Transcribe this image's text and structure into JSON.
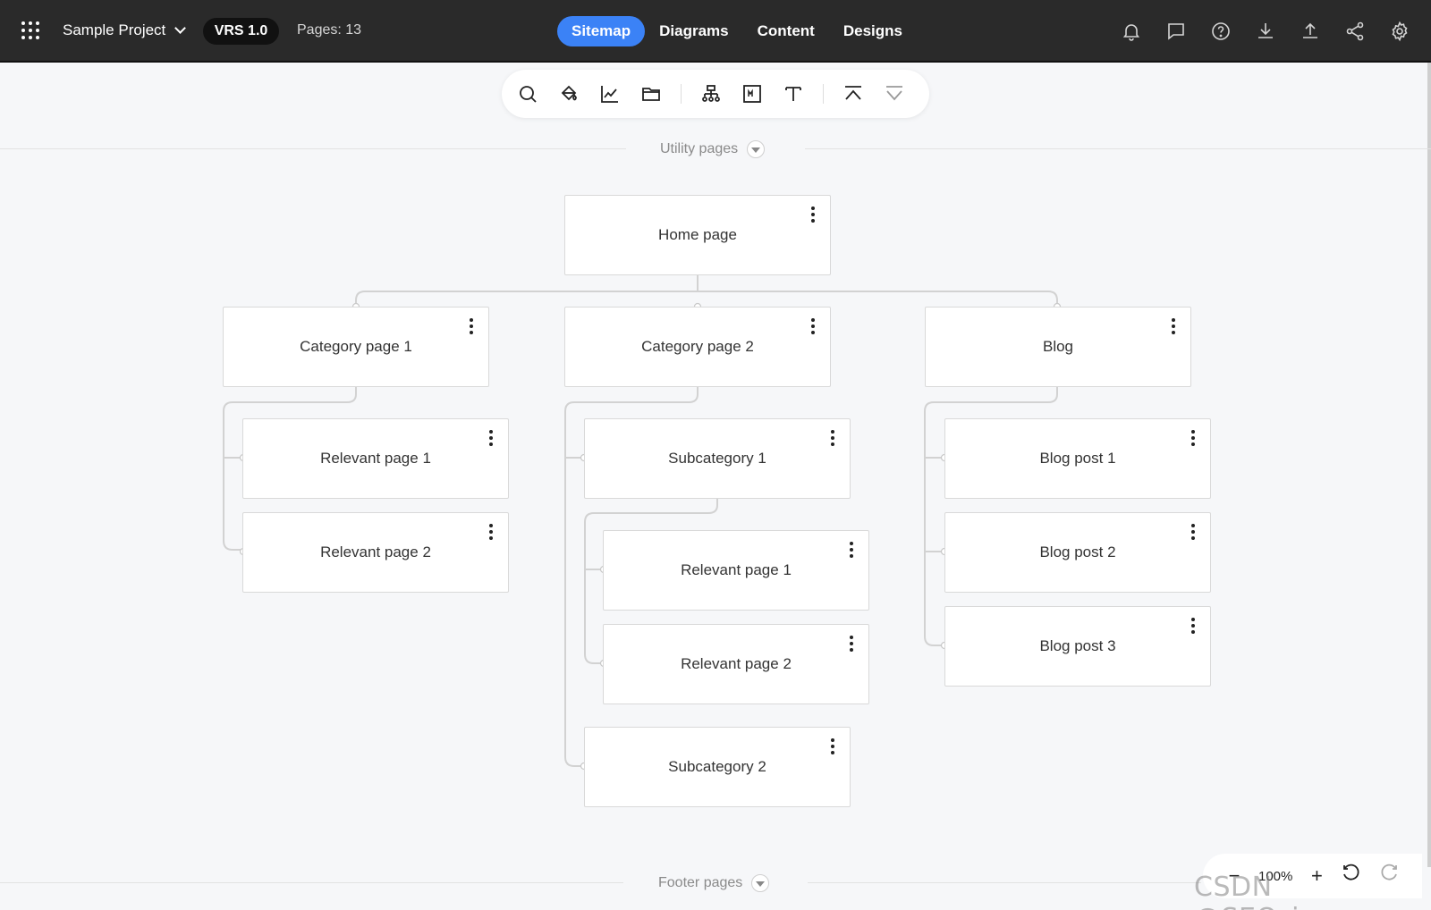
{
  "header": {
    "project_name": "Sample Project",
    "version": "VRS 1.0",
    "pages_count": "Pages: 13",
    "tabs": [
      {
        "label": "Sitemap",
        "active": true
      },
      {
        "label": "Diagrams",
        "active": false
      },
      {
        "label": "Content",
        "active": false
      },
      {
        "label": "Designs",
        "active": false
      }
    ],
    "right_icons": [
      "bell-icon",
      "comment-icon",
      "help-icon",
      "download-icon",
      "upload-icon",
      "share-icon",
      "settings-icon"
    ]
  },
  "toolbar": {
    "icons": [
      "search-icon",
      "paint-bucket-icon",
      "chart-icon",
      "folder-icon",
      "sitemap-icon",
      "markdown-icon",
      "text-icon",
      "collapse-up-icon",
      "expand-down-icon"
    ]
  },
  "sections": {
    "utility": "Utility pages",
    "footer": "Footer pages"
  },
  "sitemap": {
    "home": "Home page",
    "category1": "Category page 1",
    "category2": "Category page 2",
    "blog": "Blog",
    "c1_relevant1": "Relevant page 1",
    "c1_relevant2": "Relevant page 2",
    "subcategory1": "Subcategory 1",
    "s1_relevant1": "Relevant page 1",
    "s1_relevant2": "Relevant page 2",
    "subcategory2": "Subcategory 2",
    "blogpost1": "Blog post 1",
    "blogpost2": "Blog post 2",
    "blogpost3": "Blog post 3"
  },
  "zoom": {
    "minus": "−",
    "value": "100%",
    "plus": "+"
  },
  "watermark": "CSDN @SEO_juper",
  "colors": {
    "topbar": "#2a2a2a",
    "accent": "#3b82f6",
    "canvas": "#f6f7f9"
  }
}
